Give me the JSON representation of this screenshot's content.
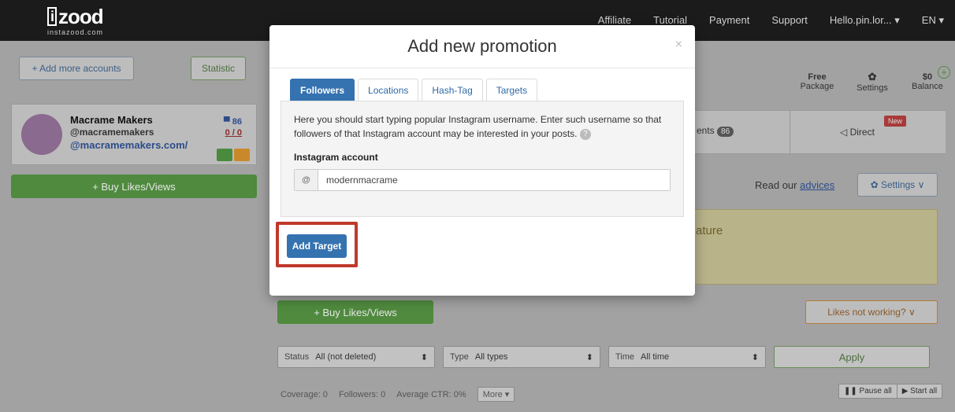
{
  "topbar": {
    "brand_name": "zood",
    "brand_mark": "i",
    "brand_domain": "instazood.com",
    "nav": [
      "Affiliate",
      "Tutorial",
      "Payment",
      "Support",
      "Hello.pin.lor... ▾",
      "EN ▾"
    ]
  },
  "left": {
    "add_accounts": "+ Add more accounts",
    "statistic": "Statistic",
    "account": {
      "name": "Macrame Makers",
      "username": "@macramemakers",
      "link": "@macramemakers.com/",
      "badge_count": "▀ 86",
      "badge_ratio": "0 / 0"
    },
    "buy_likes": "+ Buy Likes/Views"
  },
  "right": {
    "free": "Free",
    "package": "Package",
    "settings_top": "Settings",
    "balance_amount": "$0",
    "balance": "Balance",
    "ents_tab": "ents",
    "ents_count": "86",
    "direct": "◁ Direct",
    "new_badge": "New",
    "read_our": "Read our",
    "advices": "advices",
    "settings_btn": "✿ Settings ∨",
    "feature_text": "ature",
    "likes_not_working": "Likes not working? ∨",
    "buy_likes_main": "+ Buy Likes/Views"
  },
  "filters": {
    "status_label": "Status",
    "status_value": "All (not deleted)",
    "type_label": "Type",
    "type_value": "All types",
    "time_label": "Time",
    "time_value": "All time",
    "apply": "Apply"
  },
  "stats": {
    "coverage": "Coverage: 0",
    "followers": "Followers: 0",
    "avg_ctr": "Average CTR: 0%",
    "more": "More ▾",
    "pause_all": "❚❚ Pause all",
    "start_all": "▶ Start all"
  },
  "modal": {
    "title": "Add new promotion",
    "close": "×",
    "tabs": [
      "Followers",
      "Locations",
      "Hash-Tag",
      "Targets"
    ],
    "help_text": "Here you should start typing popular Instagram username. Enter such username so that followers of that Instagram account may be interested in your posts.",
    "help_icon": "?",
    "input_label": "Instagram account",
    "input_addon": "@",
    "input_value": "modernmacrame",
    "add_target": "Add Target"
  }
}
